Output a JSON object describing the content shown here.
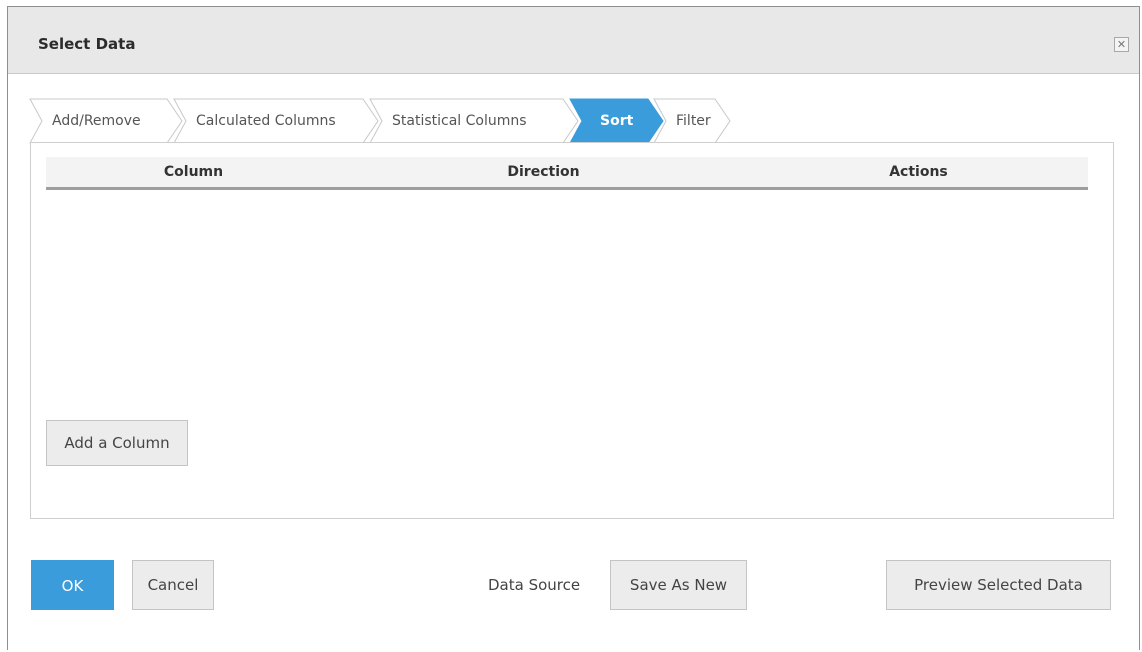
{
  "dialog": {
    "title": "Select Data",
    "close_glyph": "✕",
    "close_icon": "close-icon"
  },
  "tabs": [
    {
      "label": "Add/Remove",
      "active": false
    },
    {
      "label": "Calculated Columns",
      "active": false
    },
    {
      "label": "Statistical Columns",
      "active": false
    },
    {
      "label": "Sort",
      "active": true
    },
    {
      "label": "Filter",
      "active": false
    }
  ],
  "sort_table": {
    "columns": [
      "Column",
      "Direction",
      "Actions"
    ],
    "rows": []
  },
  "buttons": {
    "add_column": "Add a Column",
    "ok": "OK",
    "cancel": "Cancel",
    "data_source_label": "Data Source",
    "save_as_new": "Save As New",
    "preview": "Preview Selected Data"
  },
  "colors": {
    "accent": "#3b9cdb",
    "tab_fill": "#ffffff",
    "tab_border": "#c8c8c8",
    "titlebar": "#e8e8e8"
  }
}
